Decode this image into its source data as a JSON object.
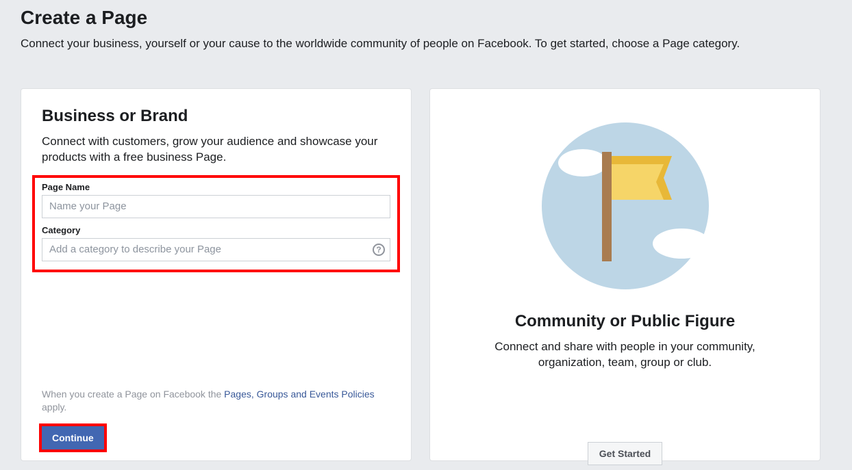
{
  "header": {
    "title": "Create a Page",
    "subtitle": "Connect your business, yourself or your cause to the worldwide community of people on Facebook. To get started, choose a Page category."
  },
  "business_card": {
    "title": "Business or Brand",
    "desc": "Connect with customers, grow your audience and showcase your products with a free business Page.",
    "page_name_label": "Page Name",
    "page_name_placeholder": "Name your Page",
    "category_label": "Category",
    "category_placeholder": "Add a category to describe your Page",
    "policy_prefix": "When you create a Page on Facebook the ",
    "policy_link": "Pages, Groups and Events Policies",
    "policy_suffix": " apply.",
    "continue_label": "Continue"
  },
  "community_card": {
    "title": "Community or Public Figure",
    "desc": "Connect and share with people in your community, organization, team, group or club.",
    "get_started_label": "Get Started"
  }
}
